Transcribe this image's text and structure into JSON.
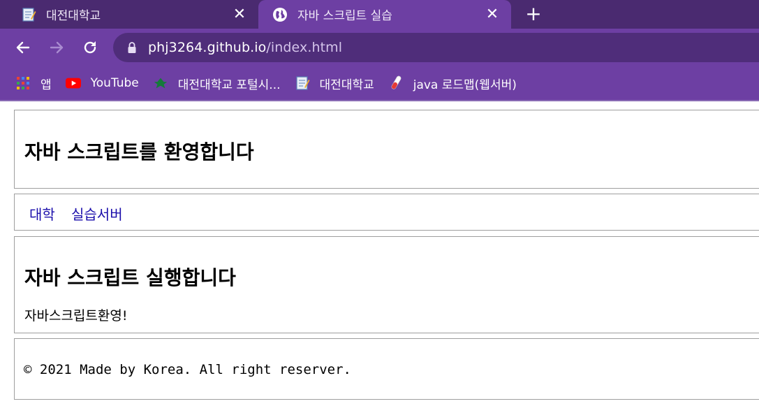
{
  "browser": {
    "tabs": [
      {
        "title": "대전대학교",
        "icon": "notepad-icon",
        "active": false
      },
      {
        "title": "자바 스크립트 실습",
        "icon": "globe-icon",
        "active": true
      }
    ],
    "close_glyph": "✕",
    "newtab_glyph": "+",
    "url": {
      "host": "phj3264.github.io",
      "path": "/index.html"
    },
    "bookmarks": [
      {
        "label": "앱",
        "icon": "apps-grid-icon"
      },
      {
        "label": "YouTube",
        "icon": "youtube-icon"
      },
      {
        "label": "대전대학교 포털시...",
        "icon": "university-logo-icon"
      },
      {
        "label": "대전대학교",
        "icon": "notepad-icon"
      },
      {
        "label": "java 로드맵(웹서버)",
        "icon": "test-tube-icon"
      }
    ],
    "colors": {
      "tabstrip": "#4a2a70",
      "toolbar": "#6d3fa3",
      "omnibox": "#4f2d7a"
    }
  },
  "page": {
    "header_title": "자바 스크립트를 환영합니다",
    "nav_links": [
      "대학",
      "실습서버"
    ],
    "main_title": "자바 스크립트 실행합니다",
    "main_text": "자바스크립트환영!",
    "footer_text": "© 2021 Made by Korea. All right reserver."
  }
}
